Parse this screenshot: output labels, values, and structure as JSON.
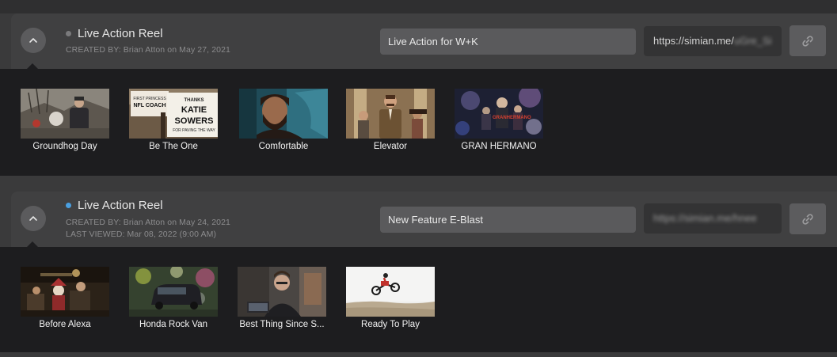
{
  "reels": [
    {
      "title": "Live Action Reel",
      "status_color": "#7a7a7c",
      "created": "CREATED BY: Brian Atton on May 27, 2021",
      "last_viewed": "",
      "name_value": "Live Action for W+K",
      "url_visible": "https://simian.me/",
      "url_blurred": "uGre_Si",
      "videos": [
        {
          "title": "Groundhog Day"
        },
        {
          "title": "Be The One"
        },
        {
          "title": "Comfortable"
        },
        {
          "title": "Elevator"
        },
        {
          "title": "GRAN HERMANO"
        }
      ]
    },
    {
      "title": "Live Action Reel",
      "status_color": "#4a9fe0",
      "created": "CREATED BY: Brian Atton on May 24, 2021",
      "last_viewed": "LAST VIEWED: Mar 08, 2022 (9:00 AM)",
      "name_value": "New Feature E-Blast",
      "url_visible": "",
      "url_blurred": "https://simian.me/hnee",
      "videos": [
        {
          "title": "Before Alexa"
        },
        {
          "title": "Honda Rock Van"
        },
        {
          "title": "Best Thing Since S..."
        },
        {
          "title": "Ready To Play"
        }
      ]
    }
  ],
  "thumbnails": {
    "groundhog": {
      "sign": ""
    },
    "be_the_one": {
      "sign_top": "NFL COACH",
      "sign_main": "THANKS\nKATIE\nSOWERS\nFOR PAVING THE WAY"
    },
    "gran_hermano": {
      "logo": "GRANHERMANO"
    }
  },
  "icons": {
    "toggle": "chevron-up-icon",
    "link": "link-icon",
    "status": "status-dot-icon"
  }
}
